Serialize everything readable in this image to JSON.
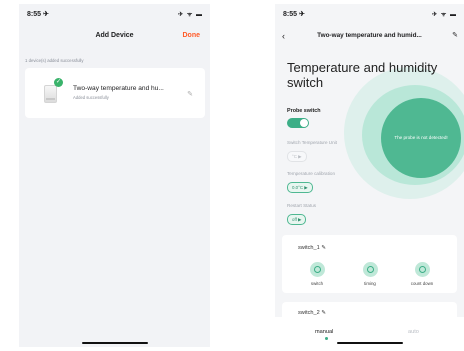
{
  "left": {
    "status": {
      "time": "8:55 ✈",
      "icons": "✈ ᯤ ▬"
    },
    "nav": {
      "title": "Add Device",
      "done_label": "Done"
    },
    "message": "1 device(s) added successfully",
    "device": {
      "name": "Two-way temperature and hu...",
      "status": "Added successfully",
      "check_glyph": "✓",
      "edit_glyph": "✎"
    }
  },
  "right": {
    "status": {
      "time": "8:55 ✈",
      "icons": "✈ ᯤ ▬"
    },
    "nav": {
      "back_glyph": "‹",
      "title": "Two-way temperature and humid...",
      "edit_glyph": "✎"
    },
    "heading": "Temperature and humidity switch",
    "probe_label": "Probe switch",
    "probe_on": true,
    "probe_circle_text": "The probe is not detected!",
    "unit_label": "Switch Temperature Unit",
    "unit_value": "°C ▶",
    "calibration_label": "Temperature calibration",
    "calibration_value": "0.0°C ▶",
    "restart_label": "Restart Status",
    "restart_value": "off ▶",
    "switch1": {
      "title": "switch_1 ✎",
      "features": [
        {
          "label": "switch"
        },
        {
          "label": "timing"
        },
        {
          "label": "count down"
        }
      ]
    },
    "switch2": {
      "title": "switch_2 ✎"
    },
    "tabs": {
      "manual": "manual",
      "auto": "auto"
    },
    "accent": "#3cae87"
  }
}
